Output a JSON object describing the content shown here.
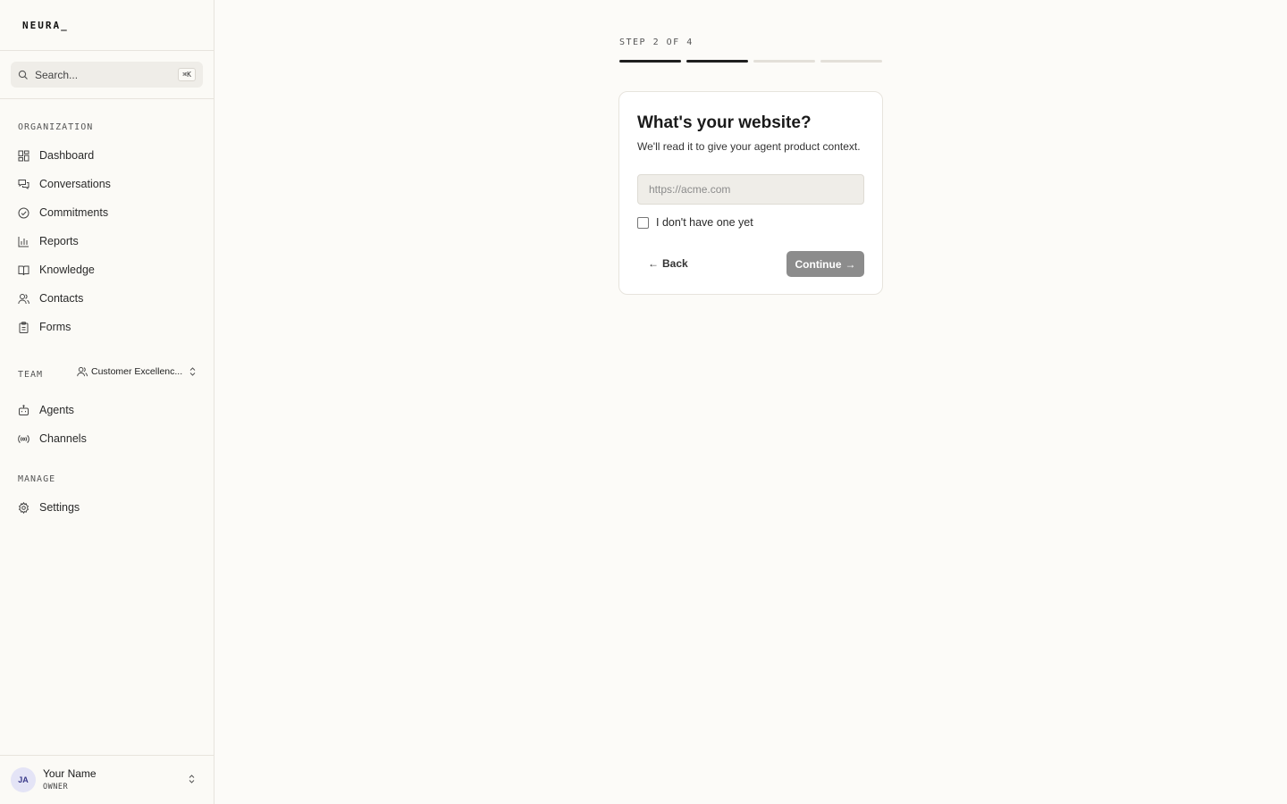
{
  "brand": {
    "name": "NEURA_"
  },
  "search": {
    "placeholder": "Search...",
    "shortcut": "⌘K"
  },
  "sidebar": {
    "organization_label": "ORGANIZATION",
    "organization_items": [
      {
        "label": "Dashboard",
        "icon": "dashboard-icon"
      },
      {
        "label": "Conversations",
        "icon": "chat-icon"
      },
      {
        "label": "Commitments",
        "icon": "check-circle-icon"
      },
      {
        "label": "Reports",
        "icon": "bar-chart-icon"
      },
      {
        "label": "Knowledge",
        "icon": "book-icon"
      },
      {
        "label": "Contacts",
        "icon": "users-icon"
      },
      {
        "label": "Forms",
        "icon": "clipboard-icon"
      }
    ],
    "team_label": "TEAM",
    "team_selected": "Customer Excellenc...",
    "team_items": [
      {
        "label": "Agents",
        "icon": "robot-icon"
      },
      {
        "label": "Channels",
        "icon": "broadcast-icon"
      }
    ],
    "manage_label": "MANAGE",
    "manage_items": [
      {
        "label": "Settings",
        "icon": "gear-icon"
      }
    ]
  },
  "user": {
    "initials": "JA",
    "name": "Your Name",
    "role": "OWNER"
  },
  "onboarding": {
    "step_label": "STEP 2 OF 4",
    "progress": {
      "current_step": 2,
      "total_steps": 4
    },
    "title": "What's your website?",
    "subtitle": "We'll read it to give your agent product context.",
    "url_placeholder": "https://acme.com",
    "url_value": "",
    "no_website_label": "I don't have one yet",
    "no_website_checked": false,
    "back_label": "Back",
    "continue_label": "Continue"
  },
  "colors": {
    "accent": "#1f1f1f",
    "continue_disabled": "#8c8c8c",
    "background": "#fcfbf8"
  }
}
